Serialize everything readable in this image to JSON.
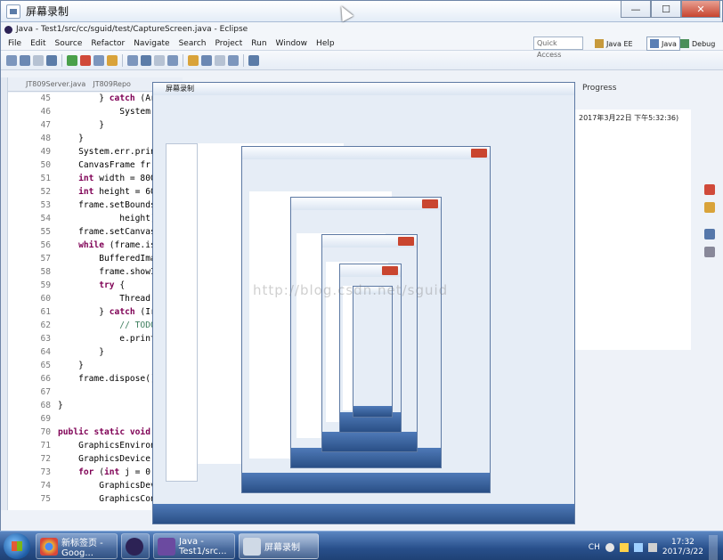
{
  "window": {
    "title": "屏幕录制",
    "minimize": "—",
    "maximize": "☐",
    "close": "✕"
  },
  "eclipse": {
    "title": "Java - Test1/src/cc/sguid/test/CaptureScreen.java - Eclipse",
    "menu": [
      "File",
      "Edit",
      "Source",
      "Refactor",
      "Navigate",
      "Search",
      "Project",
      "Run",
      "Window",
      "Help"
    ],
    "quick_access": "Quick Access",
    "perspectives": [
      "Java EE",
      "Java",
      "Debug"
    ],
    "editor_tabs": [
      "JT809Server.java",
      "JT809Repo"
    ],
    "progress_tab": "Progress",
    "progress_text": "2017年3月22日 下午5:32:36)"
  },
  "code": [
    {
      "ln": "45",
      "text": "        } catch (Ar"
    },
    {
      "ln": "46",
      "text": "            System."
    },
    {
      "ln": "47",
      "text": "        }"
    },
    {
      "ln": "48",
      "text": "    }"
    },
    {
      "ln": "49",
      "text": "    System.err.prin"
    },
    {
      "ln": "50",
      "text": "    CanvasFrame fr"
    },
    {
      "ln": "51",
      "text": "    int width = 800"
    },
    {
      "ln": "52",
      "text": "    int height = 60"
    },
    {
      "ln": "53",
      "text": "    frame.setBounds"
    },
    {
      "ln": "54",
      "text": "            height)"
    },
    {
      "ln": "55",
      "text": "    frame.setCanvas"
    },
    {
      "ln": "56",
      "text": "    while (frame.is"
    },
    {
      "ln": "57",
      "text": "        BufferedIma"
    },
    {
      "ln": "58",
      "text": "        frame.showI"
    },
    {
      "ln": "59",
      "text": "        try {"
    },
    {
      "ln": "60",
      "text": "            Thread."
    },
    {
      "ln": "61",
      "text": "        } catch (Ir"
    },
    {
      "ln": "62",
      "text": "            // TODO"
    },
    {
      "ln": "63",
      "text": "            e.print"
    },
    {
      "ln": "64",
      "text": "        }"
    },
    {
      "ln": "65",
      "text": "    }"
    },
    {
      "ln": "66",
      "text": "    frame.dispose()"
    },
    {
      "ln": "67",
      "text": ""
    },
    {
      "ln": "68",
      "text": "}"
    },
    {
      "ln": "69",
      "text": ""
    },
    {
      "ln": "70",
      "text": "public static void"
    },
    {
      "ln": "71",
      "text": "    GraphicsEnviron"
    },
    {
      "ln": "72",
      "text": "    GraphicsDevice["
    },
    {
      "ln": "73",
      "text": "    for (int j = 0;"
    },
    {
      "ln": "74",
      "text": "        GraphicsDev"
    },
    {
      "ln": "75",
      "text": "        GraphicsCon"
    }
  ],
  "watermark": "http://blog.csdn.net/sguid",
  "nested": {
    "title": "屏幕录制"
  },
  "taskbar": {
    "items": [
      {
        "label": "新标签页 - Goog...",
        "color": "#e8b23a"
      },
      {
        "label": "",
        "color": "#2c2255"
      },
      {
        "label": "Java - Test1/src...",
        "color": "#6b4aa0"
      },
      {
        "label": "屏幕录制",
        "color": "#cfd9e6"
      }
    ],
    "clock_time": "17:32",
    "clock_date": "2017/3/22",
    "ime": "CH"
  }
}
